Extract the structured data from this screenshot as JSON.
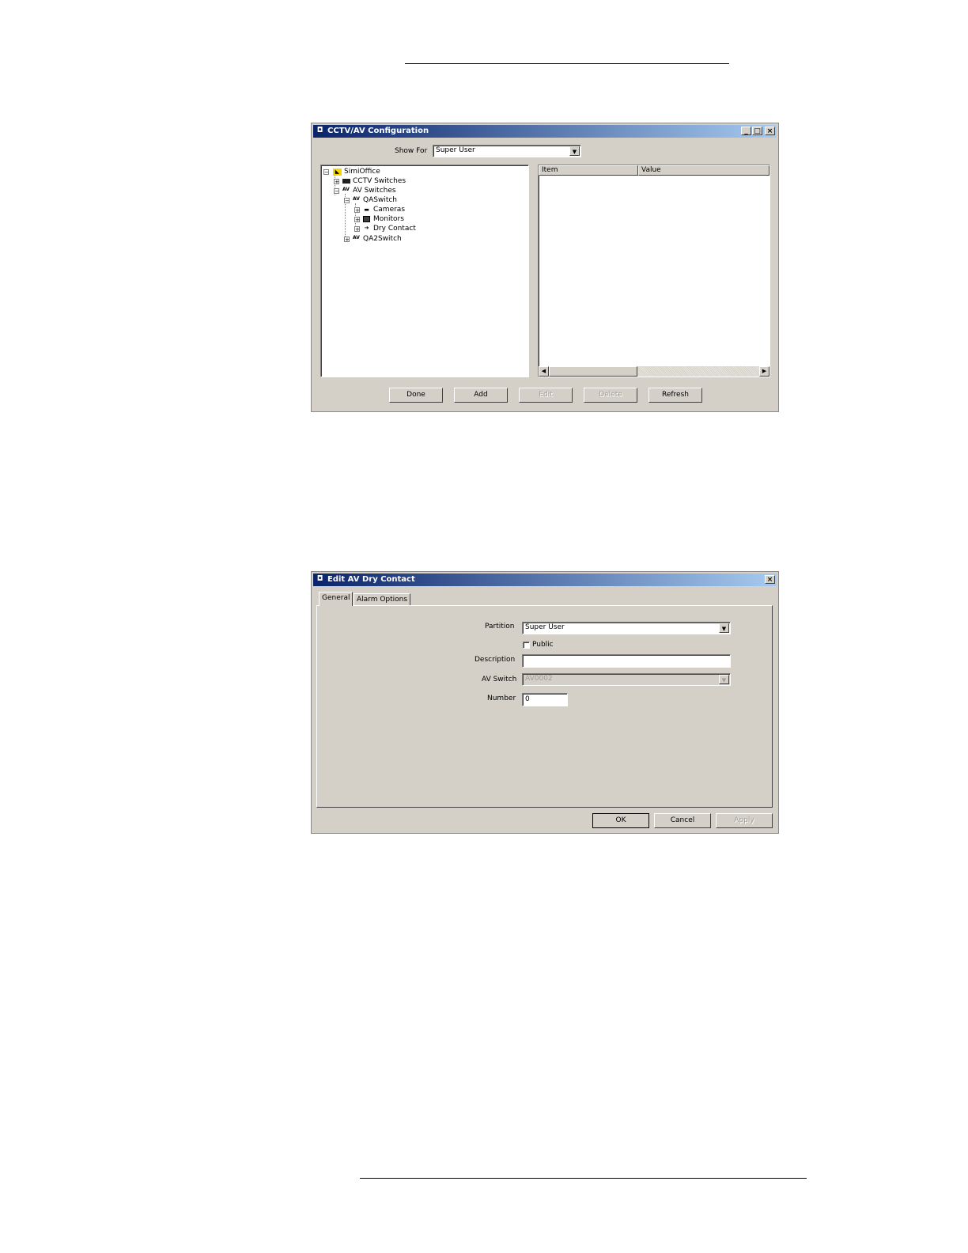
{
  "cctv_window": {
    "title": "CCTV/AV Configuration",
    "show_for_label": "Show For",
    "show_for_value": "Super User",
    "tree": [
      {
        "label": "SimiOffice",
        "expander": "−",
        "icon": "building-icon"
      },
      {
        "label": "CCTV Switches",
        "expander": "+",
        "icon": "cctv-switch-icon"
      },
      {
        "label": "AV Switches",
        "expander": "−",
        "icon": "av-icon"
      },
      {
        "label": "QASwitch",
        "expander": "−",
        "icon": "av-icon"
      },
      {
        "label": "Cameras",
        "expander": "+",
        "icon": "camera-icon"
      },
      {
        "label": "Monitors",
        "expander": "+",
        "icon": "monitor-icon"
      },
      {
        "label": "Dry Contact",
        "expander": "+",
        "icon": "dry-contact-icon"
      },
      {
        "label": "QA2Switch",
        "expander": "+",
        "icon": "av-icon"
      }
    ],
    "columns": {
      "item": "Item",
      "value": "Value"
    },
    "buttons": {
      "done": "Done",
      "add": "Add",
      "edit": "Edit",
      "delete": "Delete",
      "refresh": "Refresh"
    }
  },
  "edit_window": {
    "title": "Edit AV Dry Contact",
    "tabs": {
      "general": "General",
      "alarm_options": "Alarm Options"
    },
    "fields": {
      "partition_label": "Partition",
      "partition_value": "Super User",
      "public_label": "Public",
      "description_label": "Description",
      "description_value": "",
      "av_switch_label": "AV Switch",
      "av_switch_value": "AV0002",
      "number_label": "Number",
      "number_value": "0"
    },
    "buttons": {
      "ok": "OK",
      "cancel": "Cancel",
      "apply": "Apply"
    }
  }
}
